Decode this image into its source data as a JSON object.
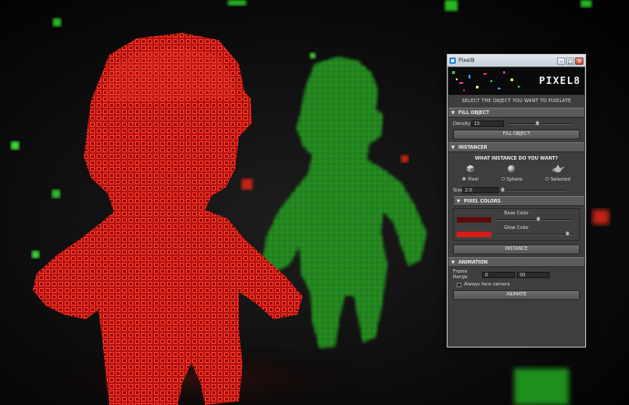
{
  "window": {
    "title": "Pixel8",
    "banner_title": "PIXEL8",
    "minimize_glyph": "–",
    "maximize_glyph": "□",
    "close_glyph": "×"
  },
  "prompt": "SELECT THE OBJECT YOU WANT TO PIXELATE",
  "fill_object": {
    "header": "FILL OBJECT",
    "density_label": "Density",
    "density_value": "15",
    "density_level": 0.45,
    "button": "FILL OBJECT"
  },
  "instancer": {
    "header": "INSTANCER",
    "question": "WHAT INSTANCE DO YOU WANT?",
    "options": [
      {
        "label": "Pixel",
        "icon": "cube-icon",
        "selected": true
      },
      {
        "label": "Sphere",
        "icon": "sphere-icon",
        "selected": false
      },
      {
        "label": "Selected",
        "icon": "teapot-icon",
        "selected": false
      }
    ],
    "size_label": "Size",
    "size_value": "2.0",
    "size_level": 0.0
  },
  "pixel_colors": {
    "header": "PIXEL COLORS",
    "base_label": "Base Color",
    "base_color": "#5c0a0a",
    "base_level": 0.55,
    "glow_label": "Glow Color",
    "glow_color": "#d81e14",
    "glow_level": 0.95
  },
  "instance_button": "INSTANCE",
  "animation": {
    "header": "ANIMATION",
    "frame_range_label": "Frame Range",
    "frame_start": "0",
    "frame_end": "50",
    "always_face_label": "Always face camera",
    "always_face_checked": false,
    "button": "ANIMATE"
  },
  "colors": {
    "red_figure": "#e82a22",
    "green_figure": "#2fd12a",
    "panel_bg": "#3e3e3e"
  }
}
